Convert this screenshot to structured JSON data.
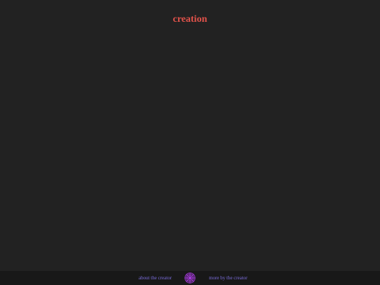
{
  "page": {
    "title": "creation",
    "background_color": "#222222",
    "title_color": "#e0524a"
  },
  "footer": {
    "about_link": "about the creator",
    "more_link": "more by the creator",
    "logo_icon": "creator-logo-icon",
    "link_color": "#7d6fe0",
    "logo_color": "#a23ad6"
  }
}
